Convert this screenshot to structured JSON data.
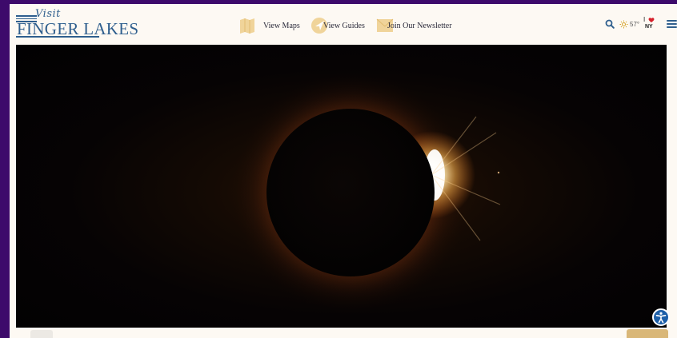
{
  "brand": {
    "logo_top": "Visit",
    "logo_main": "FINGER LAKES"
  },
  "nav": {
    "items": [
      {
        "label": "View Maps",
        "icon": "map-icon"
      },
      {
        "label": "View Guides",
        "icon": "compass-arrow-icon"
      },
      {
        "label": "Join Our Newsletter",
        "icon": "envelope-icon"
      }
    ]
  },
  "utility": {
    "temperature": "57°",
    "weather_icon": "sun-icon",
    "ny_logo_top": "I",
    "ny_logo_bottom": "NY"
  },
  "hero": {
    "image_subject": "solar-eclipse-diamond-ring"
  },
  "colors": {
    "brand_blue": "#2f5f8e",
    "gold": "#e8c98a",
    "background": "#fdf9f3",
    "frame": "#3d0a6b",
    "accessibility_blue": "#1d5fa8"
  }
}
